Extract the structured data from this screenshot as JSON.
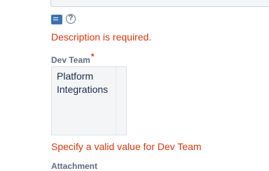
{
  "description_field": {
    "error": "Description is required.",
    "toolbar_icons": [
      "wiki-text-icon",
      "help-icon"
    ],
    "help_glyph": "?"
  },
  "dev_team_field": {
    "label": "Dev Team",
    "required_marker": "*",
    "options": [
      "Platform Integrations"
    ],
    "error": "Specify a valid value for Dev Team"
  },
  "attachment_field": {
    "label": "Attachment"
  },
  "colors": {
    "error": "#de350b",
    "label": "#5e6c84",
    "icon_blue": "#3b73af",
    "field_background": "#f4f5f7"
  }
}
